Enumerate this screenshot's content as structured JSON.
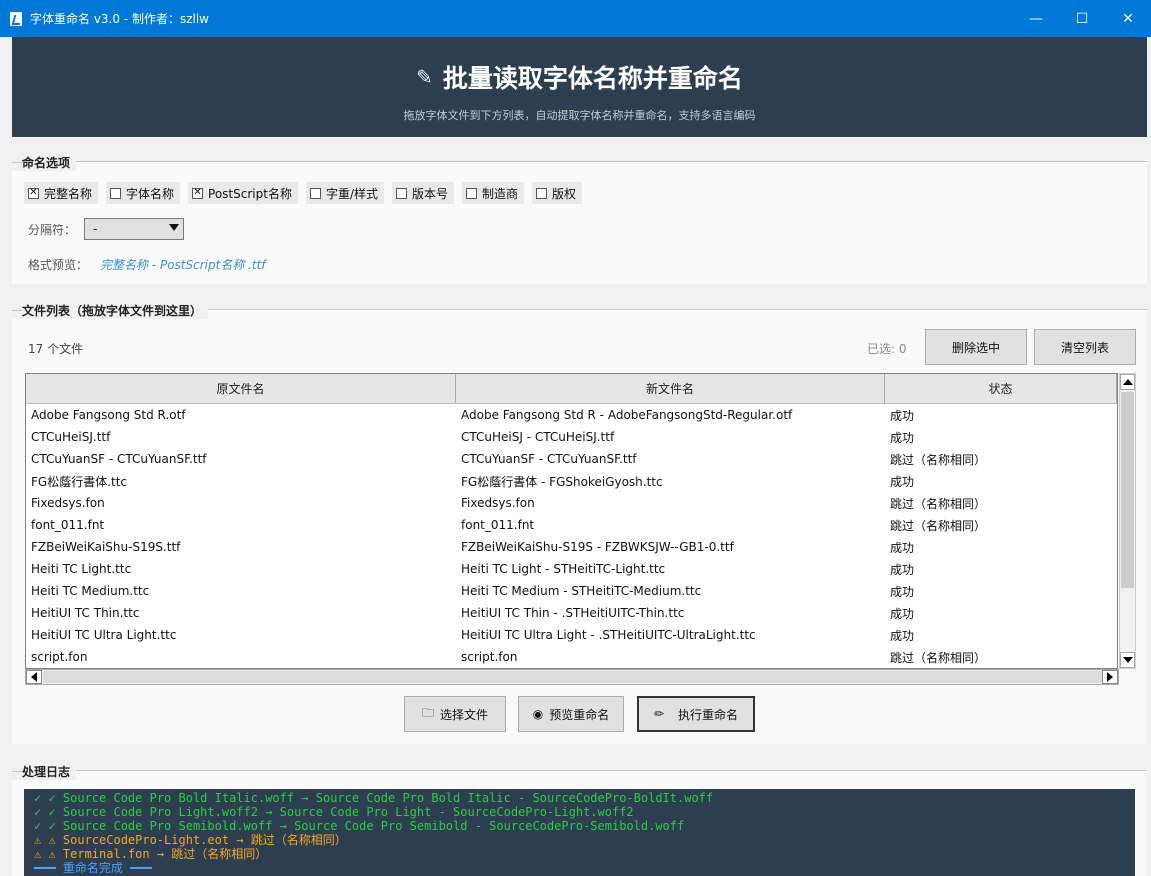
{
  "window": {
    "title": "字体重命名 v3.0 - 制作者：szllw",
    "minimize": "—",
    "maximize": "☐",
    "close": "✕"
  },
  "header": {
    "title": "批量读取字体名称并重命名",
    "subtitle": "拖放字体文件到下方列表，自动提取字体名称并重命名，支持多语言编码"
  },
  "naming_options": {
    "legend": "命名选项",
    "checkboxes": [
      {
        "label": "完整名称",
        "checked": true
      },
      {
        "label": "字体名称",
        "checked": false
      },
      {
        "label": "PostScript名称",
        "checked": true
      },
      {
        "label": "字重/样式",
        "checked": false
      },
      {
        "label": "版本号",
        "checked": false
      },
      {
        "label": "制造商",
        "checked": false
      },
      {
        "label": "版权",
        "checked": false
      }
    ],
    "separator_label": "分隔符：",
    "separator_value": "-",
    "preview_label": "格式预览：",
    "preview_value": "完整名称  -  PostScript名称 .ttf"
  },
  "file_list": {
    "legend": "文件列表（拖放字体文件到这里）",
    "count": "17 个文件",
    "selected": "已选: 0",
    "delete_button": "删除选中",
    "clear_button": "清空列表",
    "columns": [
      "原文件名",
      "新文件名",
      "状态"
    ],
    "rows": [
      [
        "Adobe Fangsong Std R.otf",
        "Adobe Fangsong Std R - AdobeFangsongStd-Regular.otf",
        "成功"
      ],
      [
        "CTCuHeiSJ.ttf",
        "CTCuHeiSJ - CTCuHeiSJ.ttf",
        "成功"
      ],
      [
        "CTCuYuanSF - CTCuYuanSF.ttf",
        "CTCuYuanSF - CTCuYuanSF.ttf",
        "跳过（名称相同）"
      ],
      [
        "FG松蔭行書体.ttc",
        "FG松蔭行書体 - FGShokeiGyosh.ttc",
        "成功"
      ],
      [
        "Fixedsys.fon",
        "Fixedsys.fon",
        "跳过（名称相同）"
      ],
      [
        "font_011.fnt",
        "font_011.fnt",
        "跳过（名称相同）"
      ],
      [
        "FZBeiWeiKaiShu-S19S.ttf",
        "FZBeiWeiKaiShu-S19S - FZBWKSJW--GB1-0.ttf",
        "成功"
      ],
      [
        "Heiti TC Light.ttc",
        "Heiti TC Light - STHeitiTC-Light.ttc",
        "成功"
      ],
      [
        "Heiti TC Medium.ttc",
        "Heiti TC Medium - STHeitiTC-Medium.ttc",
        "成功"
      ],
      [
        "HeitiUI TC Thin.ttc",
        "HeitiUI TC Thin - .STHeitiUITC-Thin.ttc",
        "成功"
      ],
      [
        "HeitiUI TC Ultra Light.ttc",
        "HeitiUI TC Ultra Light - .STHeitiUITC-UltraLight.ttc",
        "成功"
      ],
      [
        "script.fon",
        "script.fon",
        "跳过（名称相同）"
      ]
    ],
    "pick_button": "选择文件",
    "preview_button": "预览重命名",
    "run_button": "执行重命名",
    "pick_icon_glyph": "🗀",
    "preview_icon_glyph": "◉",
    "run_icon_glyph": "✏"
  },
  "log": {
    "legend": "处理日志",
    "lines": [
      {
        "kind": "ok",
        "text": "✓ ✓ Source Code Pro Bold Italic.woff → Source Code Pro Bold Italic - SourceCodePro-BoldIt.woff"
      },
      {
        "kind": "ok",
        "text": "✓ ✓ Source Code Pro Light.woff2 → Source Code Pro Light - SourceCodePro-Light.woff2"
      },
      {
        "kind": "ok",
        "text": "✓ ✓ Source Code Pro Semibold.woff → Source Code Pro Semibold - SourceCodePro-Semibold.woff"
      },
      {
        "kind": "warn",
        "text": "⚠ ⚠ SourceCodePro-Light.eot → 跳过（名称相同）"
      },
      {
        "kind": "warn",
        "text": "⚠ ⚠ Terminal.fon → 跳过（名称相同）"
      },
      {
        "kind": "info",
        "text": "━━━ 重命名完成 ━━━"
      }
    ]
  },
  "colors": {
    "titlebar": "#0078d7",
    "header_bg": "#2c3e50",
    "log_ok": "#2ecc40",
    "log_warn": "#f5a623",
    "log_info": "#4aa3ff",
    "preview_text": "#3a8fd6"
  }
}
